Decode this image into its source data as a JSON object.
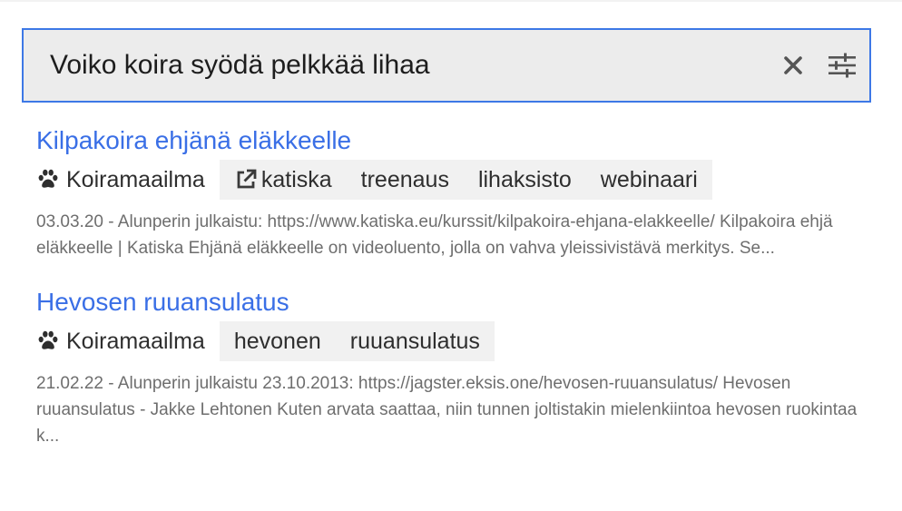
{
  "search": {
    "query": "Voiko koira syödä pelkkää lihaa",
    "clear_icon": "close-icon",
    "filter_icon": "sliders-icon"
  },
  "colors": {
    "accent": "#3a6fe6",
    "search_border": "#3d78e6",
    "search_bg": "#ececec",
    "tag_bg": "#f1f1f1",
    "snippet": "#6e6e6e"
  },
  "results": [
    {
      "title": "Kilpakoira ehjänä eläkkeelle",
      "source": "Koiramaailma",
      "source_icon": "paw-icon",
      "link_tag": "katiska",
      "link_icon": "external-link-icon",
      "tags": [
        "treenaus",
        "lihaksisto",
        "webinaari"
      ],
      "snippet": "03.03.20 - Alunperin julkaistu: https://www.katiska.eu/kurssit/kilpakoira-ehjana-elakkeelle/ Kilpakoira ehjä eläkkeelle | Katiska Ehjänä eläkkeelle on videoluento, jolla on vahva yleissivis­tävä merkitys. Se..."
    },
    {
      "title": "Hevosen ruuansulatus",
      "source": "Koiramaailma",
      "source_icon": "paw-icon",
      "tags": [
        "hevonen",
        "ruuansulatus"
      ],
      "snippet": "21.02.22 - Alunperin julkaistu 23.10.2013: https://jagster.eksis.one/hevosen-ruuansulatus/ He­vosen ruuansulatus - Jakke Lehtonen Kuten arvata saattaa, niin tunnen joltistakin mielenkiintoa hevosen ruokintaa k..."
    }
  ]
}
